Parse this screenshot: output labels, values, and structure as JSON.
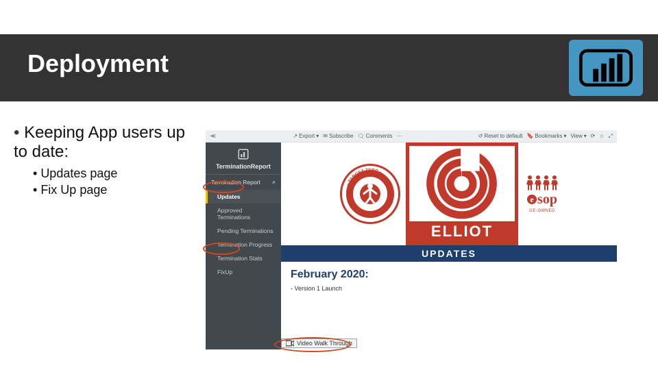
{
  "slide": {
    "title": "Deployment",
    "bullet_main": "Keeping App users up to date:",
    "sub_bullets": [
      "Updates page",
      "Fix Up page"
    ]
  },
  "app": {
    "toolbar": {
      "export": "Export",
      "subscribe": "Subscribe",
      "comments": "Comments",
      "reset": "Reset to default",
      "bookmarks": "Bookmarks",
      "view": "View"
    },
    "sidenav": {
      "report_title": "TerminationReport",
      "group_head": "Termination Report",
      "items": [
        "Updates",
        "Approved Terminations",
        "Pending Terminations",
        "Termination Progress",
        "Termination Stats",
        "FixUp"
      ]
    },
    "banner": {
      "elliot": "ELLIOT",
      "updates_bar": "UPDATES",
      "esop_label": "sop",
      "esop_sub": "GE-OWNED"
    },
    "body": {
      "month": "February 2020:",
      "line1": "- Version 1 Launch"
    },
    "bottom_tab": "Video Walk Through"
  },
  "colors": {
    "accent_red": "#c0392b",
    "accent_orange": "#d1481e",
    "navy": "#1e3e6e",
    "pbi_blue": "#4596C0"
  }
}
